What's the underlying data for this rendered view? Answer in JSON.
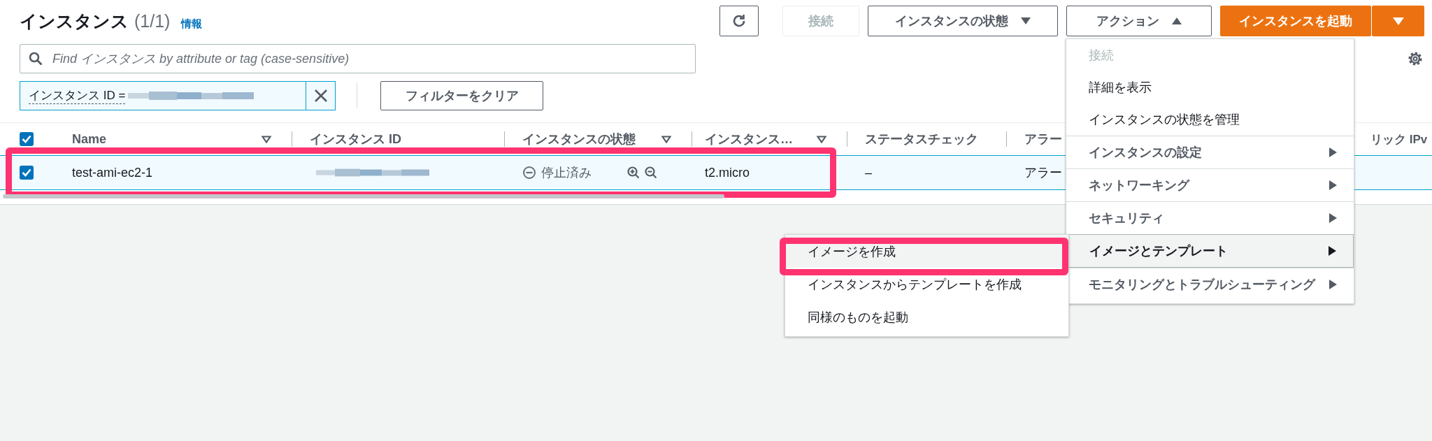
{
  "header": {
    "title": "インスタンス",
    "count": "(1/1)",
    "info_link": "情報"
  },
  "toolbar": [
    {
      "kind": "refresh"
    },
    {
      "kind": "plain",
      "label": "接続",
      "disabled": true
    },
    {
      "kind": "dropdown",
      "label": "インスタンスの状態",
      "expanded": false
    },
    {
      "kind": "dropdown",
      "label": "アクション",
      "expanded": true
    },
    {
      "kind": "primary",
      "label": "インスタンスを起動"
    },
    {
      "kind": "primary-dropdown"
    }
  ],
  "search": {
    "placeholder": "Find インスタンス by attribute or tag (case-sensitive)"
  },
  "filter": {
    "token": "インスタンス ID =",
    "value_redacted": true,
    "clear_label": "フィルターをクリア"
  },
  "table": {
    "all_selected": true,
    "columns": [
      {
        "label": "Name",
        "sortable": true
      },
      {
        "label": "インスタンス ID",
        "sortable": false
      },
      {
        "label": "インスタンスの状態",
        "sortable": true
      },
      {
        "label": "インスタンス…",
        "sortable": true
      },
      {
        "label": "ステータスチェック",
        "sortable": false
      },
      {
        "label": "アラー",
        "sortable": false
      },
      {
        "label": "リック IPv",
        "sortable": false
      }
    ],
    "rows": [
      {
        "selected": true,
        "highlighted": true,
        "name": "test-ami-ec2-1",
        "id_redacted": true,
        "state": "停止済み",
        "type": "t2.micro",
        "status_check": "–",
        "alarm": "アラー"
      }
    ]
  },
  "actions_menu": [
    {
      "label": "接続",
      "disabled": true,
      "has_submenu": false,
      "expanded": false,
      "divider_before": false
    },
    {
      "label": "詳細を表示",
      "disabled": false,
      "has_submenu": false,
      "expanded": false,
      "divider_before": false
    },
    {
      "label": "インスタンスの状態を管理",
      "disabled": false,
      "has_submenu": false,
      "expanded": false,
      "divider_before": false
    },
    {
      "label": "インスタンスの設定",
      "disabled": false,
      "has_submenu": true,
      "expanded": false,
      "divider_before": true
    },
    {
      "label": "ネットワーキング",
      "disabled": false,
      "has_submenu": true,
      "expanded": false,
      "divider_before": true
    },
    {
      "label": "セキュリティ",
      "disabled": false,
      "has_submenu": true,
      "expanded": false,
      "divider_before": true
    },
    {
      "label": "イメージとテンプレート",
      "disabled": false,
      "has_submenu": true,
      "expanded": true,
      "divider_before": true
    },
    {
      "label": "モニタリングとトラブルシューティング",
      "disabled": false,
      "has_submenu": true,
      "expanded": false,
      "divider_before": true
    }
  ],
  "submenu": [
    {
      "label": "イメージを作成",
      "highlighted": true
    },
    {
      "label": "インスタンスからテンプレートを作成",
      "highlighted": false
    },
    {
      "label": "同様のものを起動",
      "highlighted": false
    }
  ]
}
